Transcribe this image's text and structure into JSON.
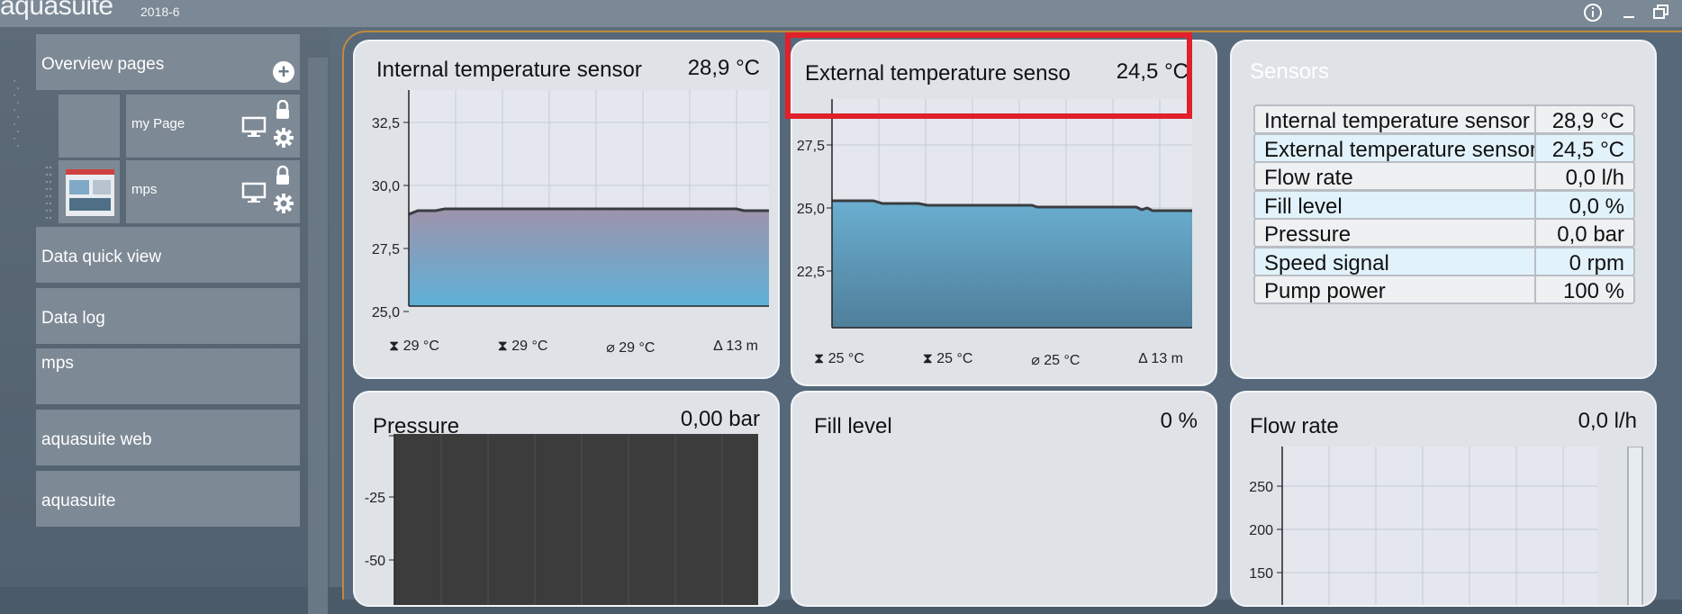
{
  "app": {
    "title": "aquasuite",
    "version": "2018-6"
  },
  "titlebar_icons": [
    "info-icon",
    "minimize-icon",
    "restore-icon"
  ],
  "sidebar": {
    "overview_label": "Overview pages",
    "pages": [
      {
        "label": "my Page"
      },
      {
        "label": "mps"
      }
    ],
    "items": [
      {
        "label": "Data quick view"
      },
      {
        "label": "Data log"
      },
      {
        "label": "mps"
      },
      {
        "label": "aquasuite web"
      },
      {
        "label": "aquasuite"
      }
    ]
  },
  "panels": {
    "internal": {
      "title": "Internal temperature sensor",
      "value": "28,9 °C",
      "y_ticks": [
        "32,5",
        "30,0",
        "27,5",
        "25,0"
      ],
      "footer": {
        "max": "29 °C",
        "min": "29 °C",
        "avg": "29 °C",
        "span": "13 m"
      }
    },
    "external": {
      "title": "External temperature sensor",
      "value": "24,5 °C",
      "y_ticks": [
        "27,5",
        "25,0",
        "22,5"
      ],
      "footer": {
        "max": "25 °C",
        "min": "25 °C",
        "avg": "25 °C",
        "span": "13 m"
      }
    },
    "sensors": {
      "title": "Sensors",
      "rows": [
        {
          "name": "Internal temperature sensor",
          "value": "28,9 °C"
        },
        {
          "name": "External temperature sensor",
          "value": "24,5 °C"
        },
        {
          "name": "Flow rate",
          "value": "0,0 l/h"
        },
        {
          "name": "Fill level",
          "value": "0,0 %"
        },
        {
          "name": "Pressure",
          "value": "0,0 bar"
        },
        {
          "name": "Speed signal",
          "value": "0 rpm"
        },
        {
          "name": "Pump power",
          "value": "100 %"
        }
      ]
    },
    "pressure": {
      "title": "Pressure",
      "value": "0,00 bar",
      "y_ticks": [
        "-25",
        "-50"
      ]
    },
    "fill": {
      "title": "Fill level",
      "value": "0 %"
    },
    "flow": {
      "title": "Flow rate",
      "value": "0,0 l/h",
      "y_ticks": [
        "250",
        "200",
        "150"
      ]
    }
  },
  "colors": {
    "highlight": "#e0202a",
    "area_fill": "#6aaed0",
    "line": "#3a3d40"
  }
}
